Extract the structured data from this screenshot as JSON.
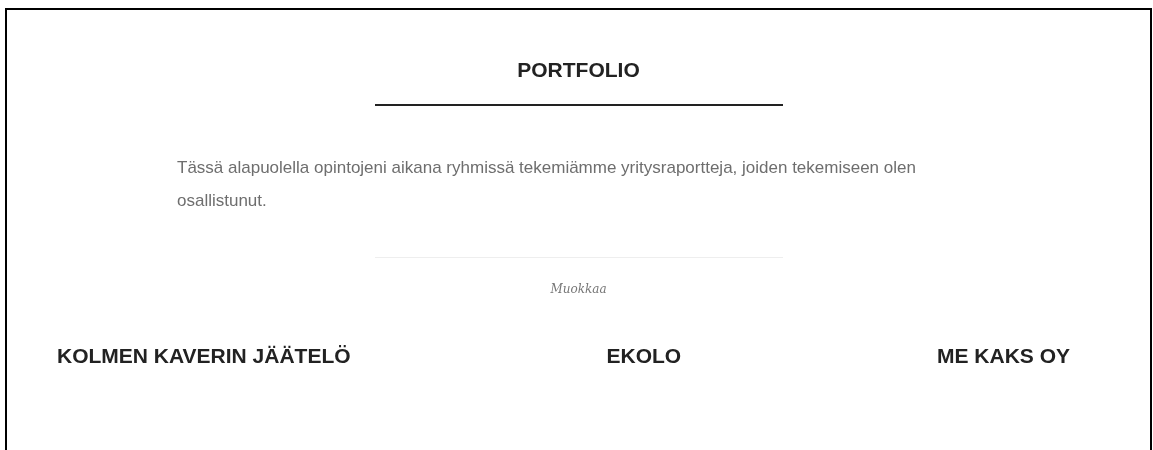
{
  "title": "PORTFOLIO",
  "intro": "Tässä alapuolella opintojeni aikana ryhmissä tekemiämme yritysraportteja, joiden tekemiseen olen osallistunut.",
  "edit_link": "Muokkaa",
  "projects": [
    {
      "title": "KOLMEN KAVERIN JÄÄTELÖ"
    },
    {
      "title": "EKOLO"
    },
    {
      "title": "ME KAKS OY"
    }
  ]
}
